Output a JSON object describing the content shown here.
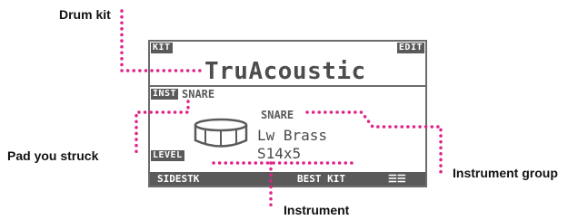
{
  "callouts": {
    "drum_kit": "Drum kit",
    "pad_you_struck": "Pad you struck",
    "instrument_group": "Instrument group",
    "instrument": "Instrument"
  },
  "lcd": {
    "kit_tag": "KIT",
    "edit_tag": "EDIT",
    "kit_name": "TruAcoustic",
    "inst_tag": "INST",
    "pad_name": "SNARE",
    "instrument_group": "SNARE",
    "instrument_name": "Lw Brass",
    "instrument_size": "S14x5",
    "level_tag": "LEVEL",
    "softkeys": [
      "SIDESTK",
      "BEST KIT",
      "☰☰"
    ]
  },
  "colors": {
    "leader": "#e0218a",
    "lcd_ink": "#5a5a5a"
  },
  "icons": [
    "drum-icon",
    "menu-icon"
  ]
}
